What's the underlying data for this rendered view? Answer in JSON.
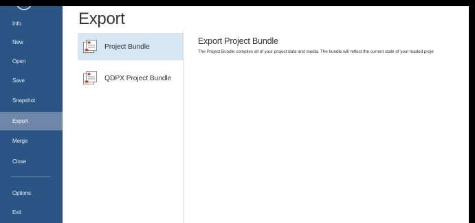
{
  "sidebar": {
    "items": [
      {
        "label": "Info"
      },
      {
        "label": "New"
      },
      {
        "label": "Open"
      },
      {
        "label": "Save"
      },
      {
        "label": "Snapshot"
      },
      {
        "label": "Export",
        "active": true
      },
      {
        "label": "Merge"
      },
      {
        "label": "Close"
      },
      {
        "label": "Options"
      },
      {
        "label": "Exit"
      }
    ],
    "background": "#2b5584",
    "active_background": "#6e87a9"
  },
  "page": {
    "title": "Export"
  },
  "options": [
    {
      "label": "Project Bundle",
      "icon": "project-bundle-icon",
      "selected": true
    },
    {
      "label": "QDPX Project Bundle",
      "icon": "qdpx-bundle-icon",
      "selected": false
    }
  ],
  "detail": {
    "title": "Export Project Bundle",
    "description": "The Project Bundle compiles all of your project data and media. The bundle will reflect the current state of your loaded proje"
  },
  "colors": {
    "selected_option": "#d6e6f3",
    "text": "#333333"
  }
}
